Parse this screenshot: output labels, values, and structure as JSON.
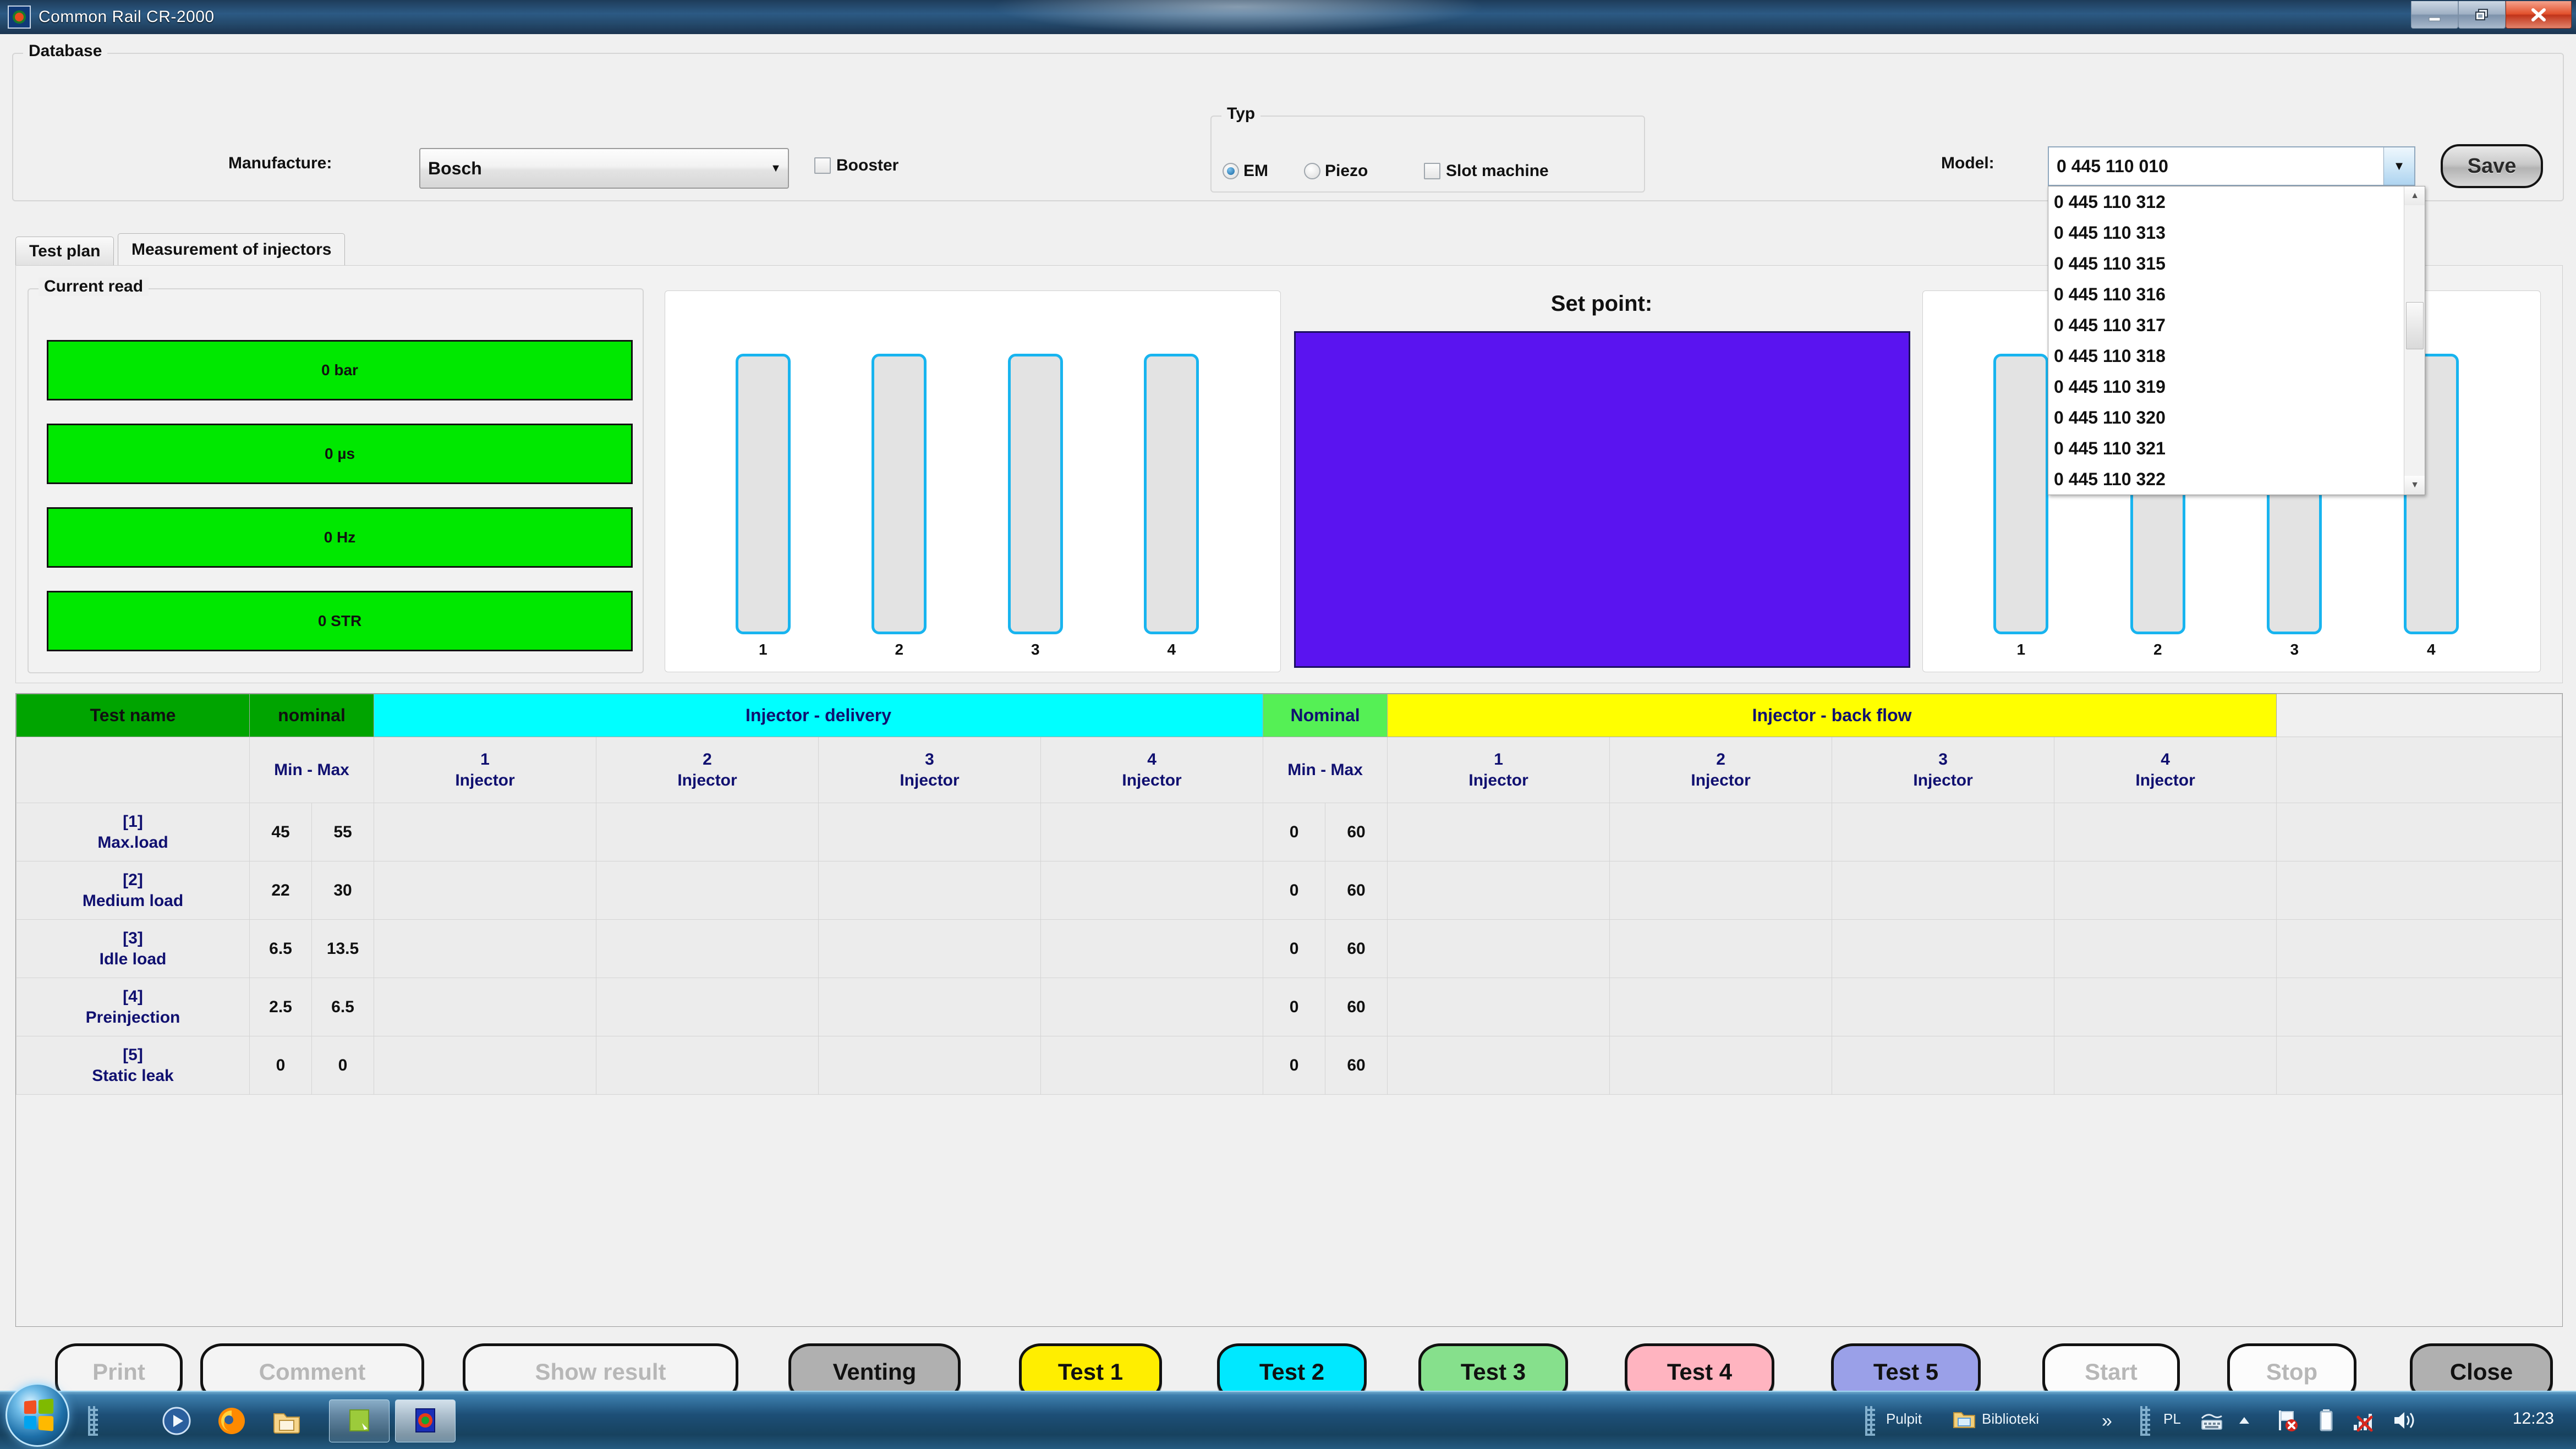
{
  "window": {
    "title": "Common Rail CR-2000",
    "icon": "app-icon",
    "controls": {
      "minimize": "minimize-icon",
      "restore": "restore-icon",
      "close": "close-icon"
    }
  },
  "database": {
    "group_label": "Database",
    "manufacture_label": "Manufacture:",
    "manufacture_value": "Bosch",
    "booster_label": "Booster",
    "booster_checked": false,
    "typ": {
      "group_label": "Typ",
      "options": [
        {
          "label": "EM",
          "type": "radio",
          "selected": true
        },
        {
          "label": "Piezo",
          "type": "radio",
          "selected": false
        },
        {
          "label": "Slot machine",
          "type": "checkbox",
          "selected": false
        }
      ]
    },
    "model_label": "Model:",
    "model_value": "0 445 110 010",
    "model_options": [
      "0 445 110 312",
      "0 445 110 313",
      "0 445 110 315",
      "0 445 110 316",
      "0 445 110 317",
      "0 445 110 318",
      "0 445 110 319",
      "0 445 110 320",
      "0 445 110 321",
      "0 445 110 322"
    ],
    "save_label": "Save"
  },
  "tabs": [
    {
      "label": "Test plan",
      "active": false
    },
    {
      "label": "Measurement of injectors",
      "active": true
    }
  ],
  "current_read": {
    "group_label": "Current read",
    "color": "#00e800",
    "values": [
      "0 bar",
      "0 µs",
      "0 Hz",
      "0 STR"
    ]
  },
  "injectors_left": {
    "labels": [
      "1",
      "2",
      "3",
      "4"
    ],
    "border_color": "#18b4ef"
  },
  "injectors_right": {
    "labels": [
      "1",
      "2",
      "3",
      "4"
    ],
    "border_color": "#18b4ef"
  },
  "set_point": {
    "title": "Set point:",
    "color": "#5a14f0"
  },
  "grid": {
    "header_top": [
      {
        "label": "Test name",
        "bg": "#00a400",
        "span": 1
      },
      {
        "label": "nominal",
        "bg": "#00a400",
        "span": 2
      },
      {
        "label": "Injector - delivery",
        "bg": "#00ffff",
        "span": 4
      },
      {
        "label": "Nominal",
        "bg": "#55f055",
        "span": 2
      },
      {
        "label": "Injector - back flow",
        "bg": "#ffff00",
        "span": 4
      }
    ],
    "header_sub": {
      "test_name": "",
      "nominal_minmax": "Min - Max",
      "delivery": [
        {
          "num": "1",
          "word": "Injector"
        },
        {
          "num": "2",
          "word": "Injector"
        },
        {
          "num": "3",
          "word": "Injector"
        },
        {
          "num": "4",
          "word": "Injector"
        }
      ],
      "nominal2_minmax": "Min - Max",
      "backflow": [
        {
          "num": "1",
          "word": "Injector"
        },
        {
          "num": "2",
          "word": "Injector"
        },
        {
          "num": "3",
          "word": "Injector"
        },
        {
          "num": "4",
          "word": "Injector"
        }
      ]
    },
    "rows": [
      {
        "index": "[1]",
        "name": "Max.load",
        "nom_min": "45",
        "nom_max": "55",
        "delivery": [
          "",
          "",
          "",
          ""
        ],
        "nom2_min": "0",
        "nom2_max": "60",
        "backflow": [
          "",
          "",
          "",
          ""
        ]
      },
      {
        "index": "[2]",
        "name": "Medium load",
        "nom_min": "22",
        "nom_max": "30",
        "delivery": [
          "",
          "",
          "",
          ""
        ],
        "nom2_min": "0",
        "nom2_max": "60",
        "backflow": [
          "",
          "",
          "",
          ""
        ]
      },
      {
        "index": "[3]",
        "name": "Idle load",
        "nom_min": "6.5",
        "nom_max": "13.5",
        "delivery": [
          "",
          "",
          "",
          ""
        ],
        "nom2_min": "0",
        "nom2_max": "60",
        "backflow": [
          "",
          "",
          "",
          ""
        ]
      },
      {
        "index": "[4]",
        "name": "Preinjection",
        "nom_min": "2.5",
        "nom_max": "6.5",
        "delivery": [
          "",
          "",
          "",
          ""
        ],
        "nom2_min": "0",
        "nom2_max": "60",
        "backflow": [
          "",
          "",
          "",
          ""
        ]
      },
      {
        "index": "[5]",
        "name": "Static leak",
        "nom_min": "0",
        "nom_max": "0",
        "delivery": [
          "",
          "",
          "",
          ""
        ],
        "nom2_min": "0",
        "nom2_max": "60",
        "backflow": [
          "",
          "",
          "",
          ""
        ]
      }
    ]
  },
  "buttons": [
    {
      "label": "Print",
      "bg": "#f4f4f4",
      "disabled": true
    },
    {
      "label": "Comment",
      "bg": "#f4f4f4",
      "disabled": true
    },
    {
      "label": "Show result",
      "bg": "#f4f4f4",
      "disabled": true
    },
    {
      "label": "Venting",
      "bg": "#b0b0b0",
      "disabled": false
    },
    {
      "label": "Test 1",
      "bg": "#ffee00",
      "disabled": false
    },
    {
      "label": "Test 2",
      "bg": "#00e8ff",
      "disabled": false
    },
    {
      "label": "Test 3",
      "bg": "#86e08c",
      "disabled": false
    },
    {
      "label": "Test 4",
      "bg": "#ffb4c0",
      "disabled": false
    },
    {
      "label": "Test 5",
      "bg": "#9aa0e8",
      "disabled": false
    },
    {
      "label": "Start",
      "bg": "#fcfcfc",
      "disabled": true
    },
    {
      "label": "Stop",
      "bg": "#fcfcfc",
      "disabled": true
    },
    {
      "label": "Close",
      "bg": "#b0b0b0",
      "disabled": false
    }
  ],
  "taskbar": {
    "start_label": "start-orb-icon",
    "quick_launch": [
      "media-player-icon",
      "firefox-icon",
      "explorer-icon"
    ],
    "tasks": [
      "notepad-task-icon",
      "common-rail-task-icon"
    ],
    "tray_items": [
      "Pulpit",
      "Biblioteki"
    ],
    "overflow": "»",
    "language": "PL",
    "tray_icons": [
      "keyboard-icon",
      "show-hidden-icon",
      "flag-error-icon",
      "battery-icon",
      "network-off-icon",
      "volume-icon"
    ],
    "clock": "12:23"
  }
}
